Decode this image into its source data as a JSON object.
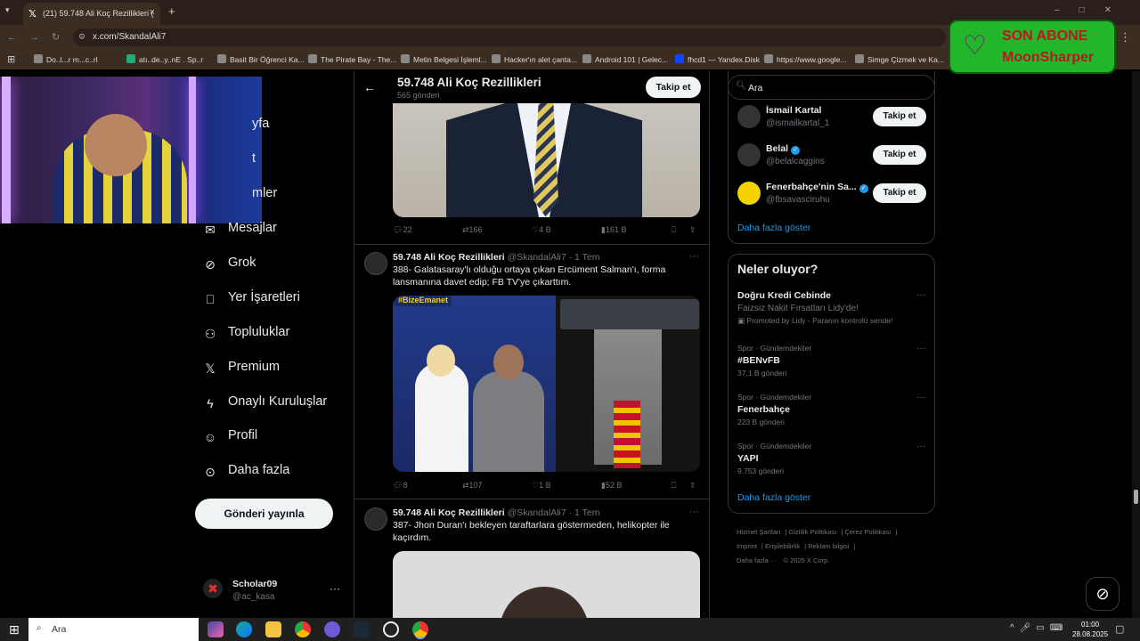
{
  "browser": {
    "tab_title": "(21) 59.748 Ali Koç Rezillikleri (",
    "url": "x.com/SkandalAli7",
    "bookmarks": [
      "Do..l...r m...c..rl",
      "atı..de..y..nE . Sp..r",
      "Basit Bir Öğrenci Ka...",
      "The Pirate Bay - The...",
      "Metin Belgesi İşleml...",
      "Hacker'ın alet çanta...",
      "Android 101 | Gelec...",
      "fhcd1 — Yandex.Disk",
      "https://www.google...",
      "Simge Çizmek ve Ka..."
    ]
  },
  "overlay": {
    "sub_line1": "SON ABONE",
    "sub_line2": "MoonSharper"
  },
  "nav": {
    "items": [
      "yfa",
      "t",
      "mler",
      "Mesajlar",
      "Grok",
      "Yer İşaretleri",
      "Topluluklar",
      "Premium",
      "Onaylı Kuruluşlar",
      "Profil",
      "Daha fazla"
    ],
    "post_button": "Gönderi yayınla",
    "account_name": "Scholar09",
    "account_handle": "@ac_kasa"
  },
  "profile": {
    "title": "59.748 Ali Koç Rezillikleri",
    "post_count": "565 gönderi",
    "follow": "Takip et"
  },
  "tweets": [
    {
      "replies": "22",
      "reposts": "166",
      "likes": "4 B",
      "views": "161 B"
    },
    {
      "author": "59.748 Ali Koç Rezillikleri",
      "handle": "@SkandalAli7",
      "time": "· 1 Tem",
      "text": "388- Galatasaray'lı olduğu ortaya çıkan Ercüment Salman'ı, forma lansmanına davet edip; FB TV'ye çıkarttım.",
      "tag": "#BizeEmanet",
      "replies": "8",
      "reposts": "107",
      "likes": "1 B",
      "views": "52 B"
    },
    {
      "author": "59.748 Ali Koç Rezillikleri",
      "handle": "@SkandalAli7",
      "time": "· 1 Tem",
      "text": "387- Jhon Duran'ı bekleyen taraftarlara göstermeden, helikopter ile kaçırdım."
    }
  ],
  "sidebar": {
    "search_placeholder": "Ara",
    "who_to_follow": [
      {
        "name": "İsmail Kartal",
        "handle": "@ismailkartal_1",
        "verified": false,
        "button": "Takip et"
      },
      {
        "name": "Belal",
        "handle": "@belalcaggins",
        "verified": true,
        "button": "Takip et"
      },
      {
        "name": "Fenerbahçe'nin Sa...",
        "handle": "@fbsavasciruhu",
        "verified": true,
        "button": "Takip et"
      }
    ],
    "show_more": "Daha fazla göster",
    "trends_title": "Neler oluyor?",
    "trends": [
      {
        "context": "",
        "title": "Doğru Kredi Cebinde",
        "sub1": "Faizsiz Nakit Fırsatları Lidy'de!",
        "sub2": "Promoted by Lidy - Paranın kontrolü sende!"
      },
      {
        "context": "Spor · Gündemdekiler",
        "title": "#BENvFB",
        "posts": "37,1 B gönderi"
      },
      {
        "context": "Spor · Gündemdekiler",
        "title": "Fenerbahçe",
        "posts": "223 B gönderi"
      },
      {
        "context": "Spor · Gündemdekiler",
        "title": "YAPI",
        "posts": "9.753 gönderi"
      }
    ],
    "footer": [
      "Hizmet Şartları",
      "Gizlilik Politikası",
      "Çerez Politikası",
      "Imprint",
      "Erişilebilirlik",
      "Reklam bilgisi",
      "Daha fazla ···",
      "© 2025 X Corp."
    ]
  },
  "taskbar": {
    "search": "Ara",
    "time": "01:00",
    "date": "28.08.2025"
  }
}
